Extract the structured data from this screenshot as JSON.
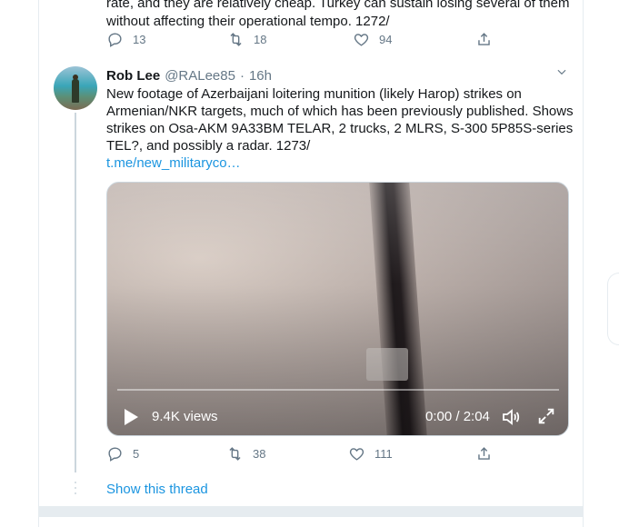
{
  "previous_tweet": {
    "text": "rate, and they are relatively cheap. Turkey can sustain losing several of them without affecting their operational tempo. 1272/",
    "replies": "13",
    "retweets": "18",
    "likes": "94"
  },
  "tweet": {
    "name": "Rob Lee",
    "handle": "@RALee85",
    "dot": "·",
    "time": "16h",
    "text": "New footage of Azerbaijani loitering munition (likely Harop) strikes on Armenian/NKR targets, much of which has been previously published. Shows strikes on Osa-AKM 9A33BM TELAR, 2 trucks, 2 MLRS, S-300 5P85S-series TEL?, and possibly a radar. 1273/",
    "link": "t.me/new_militaryco…",
    "video": {
      "views": "9.4K views",
      "time": "0:00 / 2:04"
    },
    "replies": "5",
    "retweets": "38",
    "likes": "111"
  },
  "show_thread_label": "Show this thread",
  "icons": {
    "reply": "reply-icon",
    "retweet": "retweet-icon",
    "like": "heart-icon",
    "share": "share-icon",
    "caret": "chevron-down-icon",
    "play": "play-icon",
    "volume": "volume-icon",
    "fullscreen": "fullscreen-icon"
  },
  "colors": {
    "link": "#1b95e0",
    "muted": "#657786",
    "text": "#14171a"
  }
}
